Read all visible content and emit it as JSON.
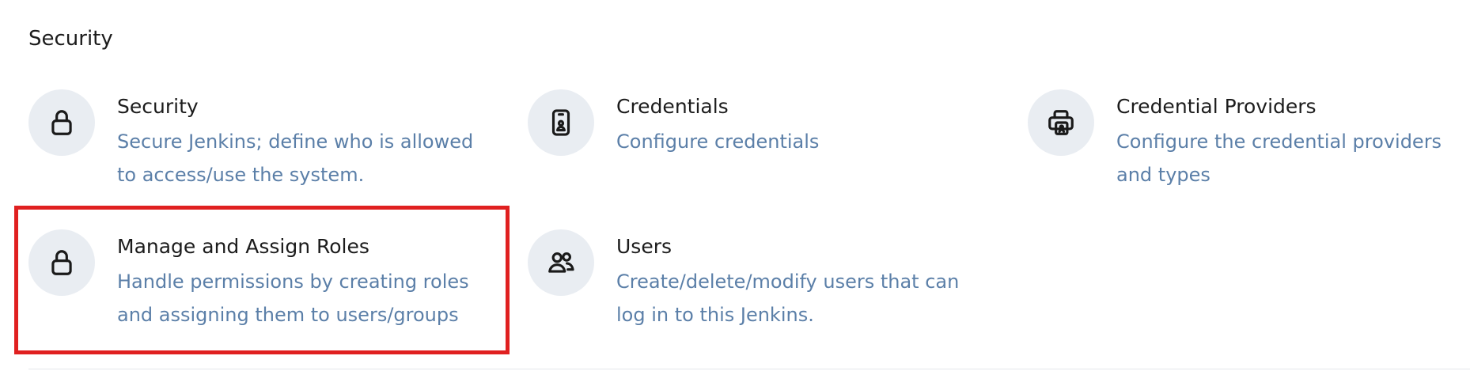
{
  "section": {
    "title": "Security"
  },
  "items": [
    {
      "icon": "lock-icon",
      "title": "Security",
      "desc_line1": "Secure Jenkins; define who is allowed",
      "desc_line2": "to access/use the system."
    },
    {
      "icon": "id-badge-icon",
      "title": "Credentials",
      "desc_line1": "Configure credentials",
      "desc_line2": ""
    },
    {
      "icon": "printer-id-icon",
      "title": "Credential Providers",
      "desc_line1": "Configure the credential providers",
      "desc_line2": "and types"
    },
    {
      "icon": "lock-icon",
      "title": "Manage and Assign Roles",
      "desc_line1": "Handle permissions by creating roles",
      "desc_line2": "and assigning them to users/groups"
    },
    {
      "icon": "users-icon",
      "title": "Users",
      "desc_line1": "Create/delete/modify users that can",
      "desc_line2": "log in to this Jenkins."
    }
  ],
  "colors": {
    "description": "#5b7fa8",
    "icon_bg": "#e9edf2",
    "highlight": "#e02020"
  }
}
